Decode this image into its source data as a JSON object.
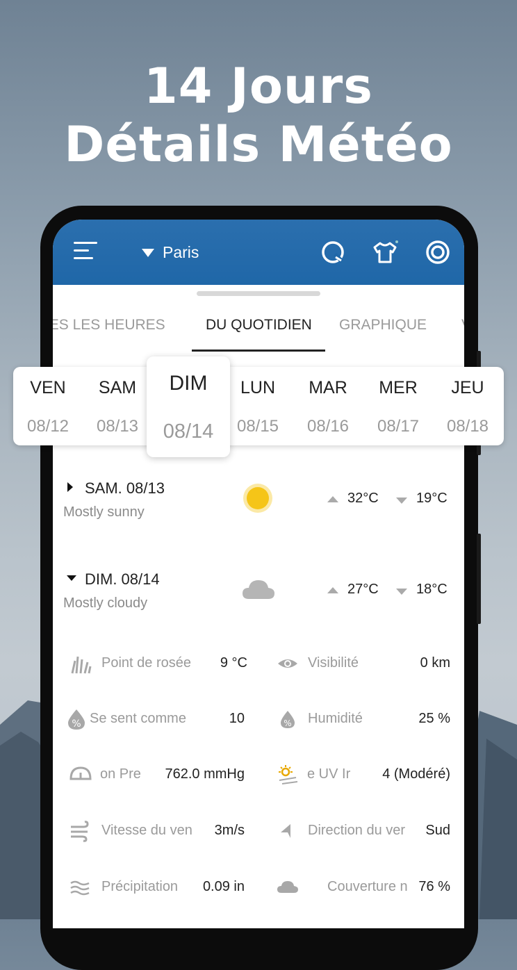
{
  "headline": {
    "line1": "14 Jours",
    "line2": "Détails Météo"
  },
  "appbar": {
    "city": "Paris"
  },
  "tabs": [
    {
      "label": "TOUTES LES HEURES"
    },
    {
      "label": "DU QUOTIDIEN"
    },
    {
      "label": "GRAPHIQUE"
    },
    {
      "label": "V"
    }
  ],
  "days": [
    {
      "name": "VEN",
      "date": "08/12"
    },
    {
      "name": "SAM",
      "date": "08/13"
    },
    {
      "name": "DIM",
      "date": "08/14"
    },
    {
      "name": "LUN",
      "date": "08/15"
    },
    {
      "name": "MAR",
      "date": "08/16"
    },
    {
      "name": "MER",
      "date": "08/17"
    },
    {
      "name": "JEU",
      "date": "08/18"
    }
  ],
  "forecast": [
    {
      "date": "SAM. 08/13",
      "desc": "Mostly sunny",
      "icon": "sun-icon",
      "high": "32°C",
      "low": "19°C",
      "expanded": false
    },
    {
      "date": "DIM. 08/14",
      "desc": "Mostly cloudy",
      "icon": "cloud-icon",
      "high": "27°C",
      "low": "18°C",
      "expanded": true
    }
  ],
  "details": [
    {
      "label": "Point de rosée",
      "value": "9 °C",
      "icon": "dew-icon"
    },
    {
      "label": "Visibilité",
      "value": "0 km",
      "icon": "eye-icon"
    },
    {
      "label": "Se sent comme",
      "value": "10",
      "icon": "percent-drop-icon"
    },
    {
      "label": "Humidité",
      "value": "25 %",
      "icon": "humidity-icon"
    },
    {
      "label": "on    Pre",
      "value": "762.0 mmHg",
      "icon": "pressure-icon"
    },
    {
      "label": "e UV     Ir",
      "value": "4 (Modéré)",
      "icon": "uv-icon"
    },
    {
      "label": "Vitesse du ven",
      "value": "3m/s",
      "icon": "wind-icon"
    },
    {
      "label": "Direction du ver",
      "value": "Sud",
      "icon": "direction-icon"
    },
    {
      "label": "Précipitation",
      "value": "0.09 in",
      "icon": "precipitation-icon"
    },
    {
      "label": "Couverture n",
      "value": "76 %",
      "icon": "cloud-cover-icon"
    }
  ],
  "colors": {
    "appbar": "#1f67a8",
    "sun": "#f5c518",
    "cloud": "#b5b5b5"
  }
}
